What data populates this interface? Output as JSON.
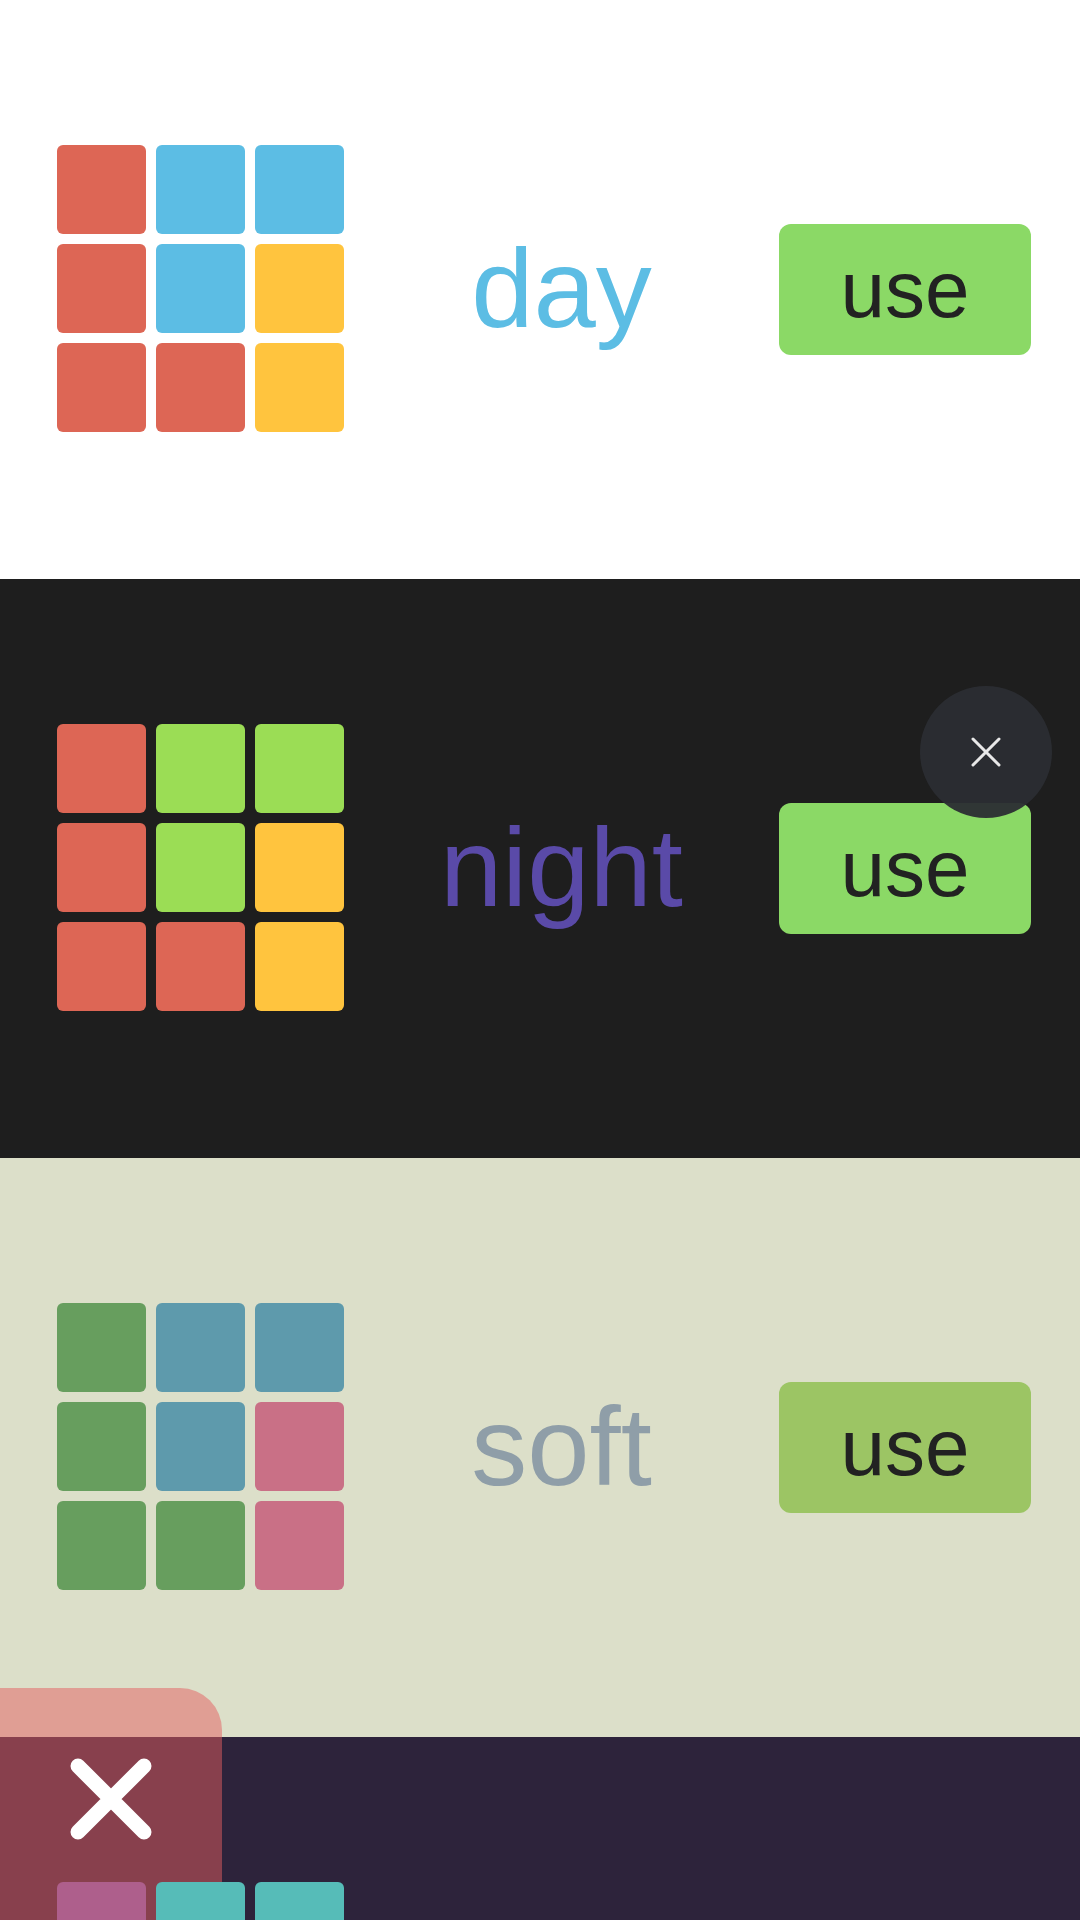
{
  "themes": [
    {
      "color": "#ffffff",
      "tiles": [
        {
          "color": "#dd6655"
        },
        {
          "color": "#5cbde4"
        },
        {
          "color": "#5cbde4"
        },
        {
          "color": "#dd6655"
        },
        {
          "color": "#5cbde4"
        },
        {
          "color": "#ffc43e"
        },
        {
          "color": "#dd6655"
        },
        {
          "color": "#dd6655"
        },
        {
          "color": "#ffc43e"
        }
      ],
      "title": {
        "text": "day",
        "color": "#5cbde4"
      },
      "button": {
        "label": "use",
        "color": "#8bd966"
      }
    },
    {
      "color": "#1e1e1e",
      "tiles": [
        {
          "color": "#dd6655"
        },
        {
          "color": "#9bdd55"
        },
        {
          "color": "#9bdd55"
        },
        {
          "color": "#dd6655"
        },
        {
          "color": "#9bdd55"
        },
        {
          "color": "#ffc43e"
        },
        {
          "color": "#dd6655"
        },
        {
          "color": "#dd6655"
        },
        {
          "color": "#ffc43e"
        }
      ],
      "title": {
        "text": "night",
        "color": "#5a4aa8"
      },
      "button": {
        "label": "use",
        "color": "#8bd966"
      }
    },
    {
      "color": "#dcdfc9",
      "tiles": [
        {
          "color": "#679e5e"
        },
        {
          "color": "#5e9aac"
        },
        {
          "color": "#5e9aac"
        },
        {
          "color": "#679e5e"
        },
        {
          "color": "#5e9aac"
        },
        {
          "color": "#c97086"
        },
        {
          "color": "#679e5e"
        },
        {
          "color": "#679e5e"
        },
        {
          "color": "#c97086"
        }
      ],
      "title": {
        "text": "soft",
        "color": "#8f9ea8"
      },
      "button": {
        "label": "use",
        "color": "#9cc564"
      }
    },
    {
      "color": "#2d233b",
      "tiles": [
        {
          "color": "#ae5f8c"
        },
        {
          "color": "#56bcb8"
        },
        {
          "color": "#56bcb8"
        }
      ]
    }
  ]
}
